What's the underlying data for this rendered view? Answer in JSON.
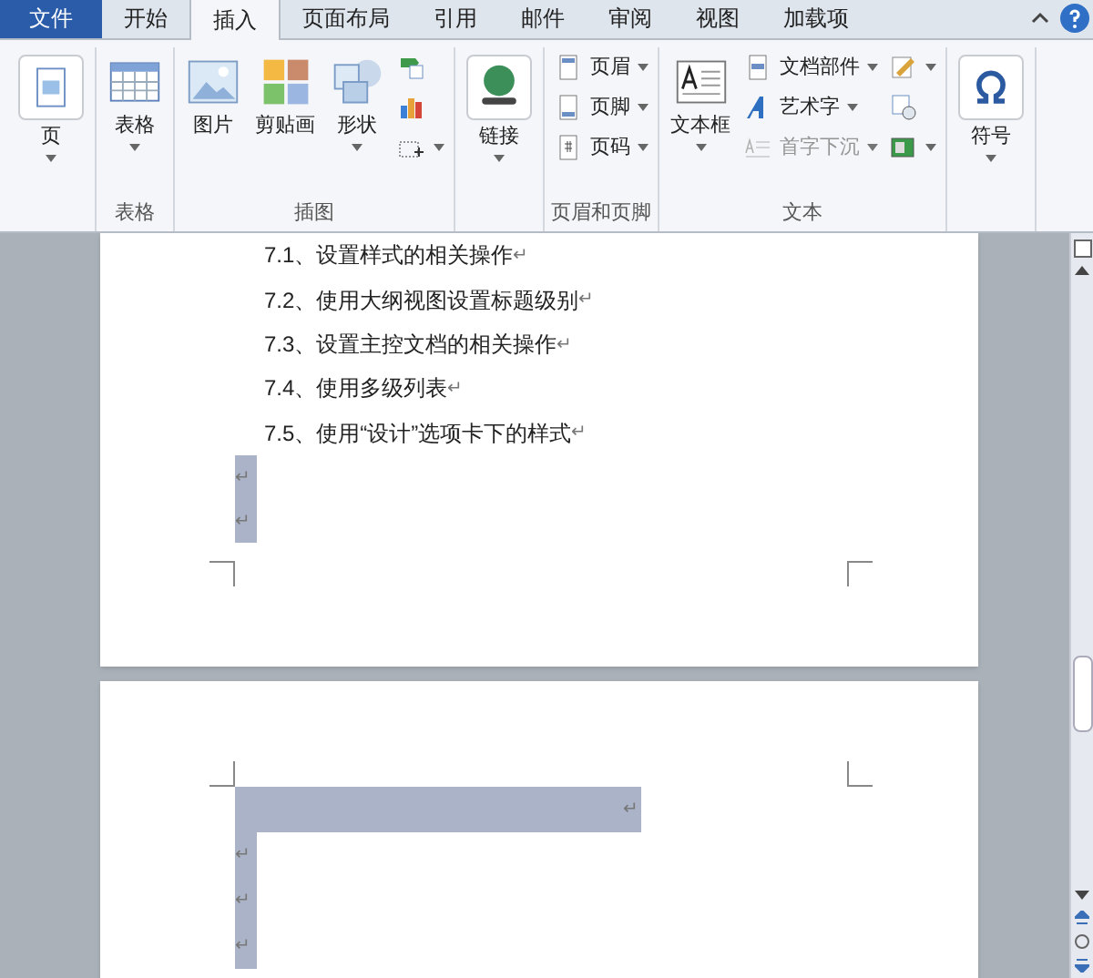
{
  "tabs": [
    {
      "label": "文件",
      "kind": "file",
      "selected": false
    },
    {
      "label": "开始",
      "kind": "normal",
      "selected": false
    },
    {
      "label": "插入",
      "kind": "normal",
      "selected": true
    },
    {
      "label": "页面布局",
      "kind": "normal",
      "selected": false
    },
    {
      "label": "引用",
      "kind": "normal",
      "selected": false
    },
    {
      "label": "邮件",
      "kind": "normal",
      "selected": false
    },
    {
      "label": "审阅",
      "kind": "normal",
      "selected": false
    },
    {
      "label": "视图",
      "kind": "normal",
      "selected": false
    },
    {
      "label": "加载项",
      "kind": "normal",
      "selected": false
    }
  ],
  "ribbon": {
    "groups": [
      {
        "columns": [
          [
            {
              "kind": "large",
              "label": "页",
              "dropdown": true,
              "disabled": false
            }
          ]
        ]
      },
      {
        "label": "表格",
        "columns": [
          [
            {
              "kind": "large",
              "label": "表格",
              "dropdown": true,
              "disabled": false
            }
          ]
        ]
      },
      {
        "label": "插图",
        "columns": [
          [
            {
              "kind": "large",
              "label": "图片",
              "dropdown": false,
              "disabled": false
            }
          ],
          [
            {
              "kind": "large",
              "label": "剪贴画",
              "dropdown": false,
              "disabled": false
            }
          ],
          [
            {
              "kind": "large",
              "label": "形状",
              "dropdown": true,
              "disabled": false
            }
          ],
          [
            {
              "kind": "small",
              "dropdown": false,
              "disabled": false
            },
            {
              "kind": "small",
              "dropdown": false,
              "disabled": false
            },
            {
              "kind": "small",
              "dropdown": true,
              "disabled": false
            }
          ]
        ]
      },
      {
        "columns": [
          [
            {
              "kind": "large",
              "label": "链接",
              "dropdown": true,
              "disabled": false
            }
          ]
        ]
      },
      {
        "label": "页眉和页脚",
        "columns": [
          [
            {
              "kind": "small",
              "label": "页眉",
              "dropdown": true,
              "disabled": false
            },
            {
              "kind": "small",
              "label": "页脚",
              "dropdown": true,
              "disabled": false
            },
            {
              "kind": "small",
              "label": "页码",
              "dropdown": true,
              "disabled": false
            }
          ]
        ]
      },
      {
        "label": "文本",
        "columns": [
          [
            {
              "kind": "large",
              "label": "文本框",
              "dropdown": true,
              "disabled": false
            }
          ],
          [
            {
              "kind": "small",
              "label": "文档部件",
              "dropdown": true,
              "disabled": false
            },
            {
              "kind": "small",
              "label": "艺术字",
              "dropdown": true,
              "disabled": false
            },
            {
              "kind": "small",
              "label": "首字下沉",
              "dropdown": true,
              "disabled": true
            }
          ],
          [
            {
              "kind": "small",
              "dropdown": true,
              "disabled": false
            },
            {
              "kind": "small",
              "dropdown": false,
              "disabled": false
            },
            {
              "kind": "small",
              "dropdown": true,
              "disabled": false
            }
          ]
        ]
      },
      {
        "columns": [
          [
            {
              "kind": "large",
              "label": "符号",
              "dropdown": true,
              "disabled": false
            }
          ]
        ]
      }
    ]
  },
  "pages": [
    {
      "lines": [
        {
          "kind": "text",
          "text": "7.1、设置样式的相关操作",
          "mark": "↵",
          "highlighted": false
        },
        {
          "kind": "text",
          "text": "7.2、使用大纲视图设置标题级别",
          "mark": "↵",
          "highlighted": false
        },
        {
          "kind": "text",
          "text": "7.3、设置主控文档的相关操作",
          "mark": "↵",
          "highlighted": false
        },
        {
          "kind": "text",
          "text": "7.4、使用多级列表",
          "mark": "↵",
          "highlighted": false
        },
        {
          "kind": "text",
          "text": "7.5、使用“设计”选项卡下的样式",
          "mark": "↵",
          "highlighted": false
        },
        {
          "kind": "blank",
          "mark": "↵",
          "highlighted": true
        },
        {
          "kind": "blank",
          "mark": "↵",
          "highlighted": true
        }
      ]
    },
    {
      "lines": [
        {
          "kind": "wide",
          "mark": "↵",
          "highlighted": true
        },
        {
          "kind": "blank",
          "mark": "↵",
          "highlighted": true
        },
        {
          "kind": "blank",
          "mark": "↵",
          "highlighted": true
        },
        {
          "kind": "blank",
          "mark": "↵",
          "highlighted": true
        }
      ]
    }
  ]
}
